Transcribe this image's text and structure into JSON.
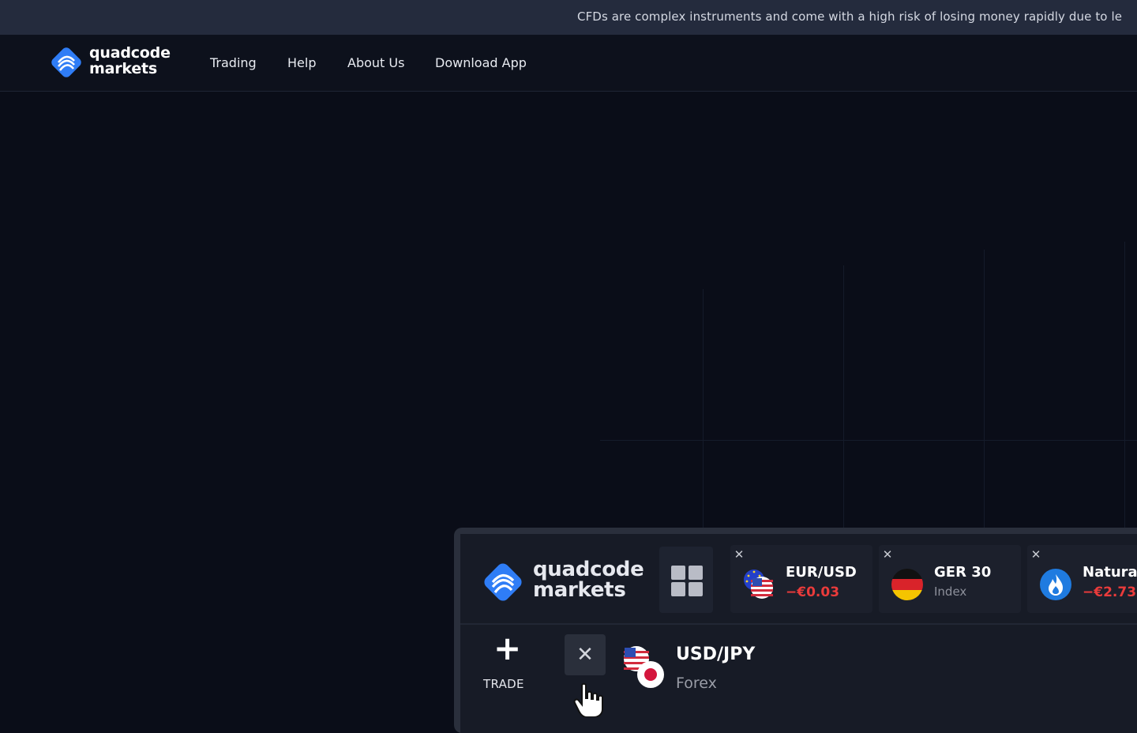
{
  "risk_warning": "CFDs are complex instruments and come with a high risk of losing money rapidly due to le",
  "brand": {
    "line1": "quadcode",
    "line2": "markets",
    "color": "#2f7df6"
  },
  "nav": [
    {
      "label": "Trading"
    },
    {
      "label": "Help"
    },
    {
      "label": "About Us"
    },
    {
      "label": "Download App"
    }
  ],
  "mockup": {
    "brand_line1": "quadcode",
    "brand_line2": "markets",
    "tabs": [
      {
        "name": "EUR/USD",
        "sub": "−€0.03",
        "sub_style": "negative",
        "icon": "eu-us-flag-icon"
      },
      {
        "name": "GER 30",
        "sub": "Index",
        "sub_style": "muted",
        "icon": "germany-flag-icon"
      },
      {
        "name": "Natural",
        "sub": "−€2.73",
        "sub_style": "negative",
        "icon": "flame-icon"
      }
    ],
    "trade_label": "TRADE",
    "instrument": {
      "name": "USD/JPY",
      "category": "Forex",
      "icon": "us-jp-flag-icon"
    }
  },
  "colors": {
    "negative": "#ea3b3b",
    "accent": "#2f7df6"
  }
}
